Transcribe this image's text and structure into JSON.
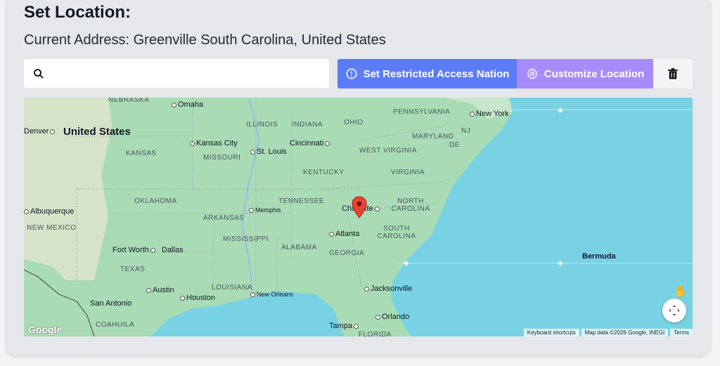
{
  "header": {
    "title": "Set Location:",
    "current_address": "Current Address: Greenville South Carolina, United States"
  },
  "search": {
    "placeholder": "",
    "value": "",
    "icon": "search-icon"
  },
  "buttons": {
    "restricted_label": "Set Restricted Access Nation",
    "restricted_icon": "alert-circle-icon",
    "restricted_color": "#5b7cf6",
    "customize_label": "Customize Location",
    "customize_icon": "gear-icon",
    "customize_color": "#a78bfa",
    "delete_icon": "trash-icon"
  },
  "map": {
    "country_label": "United States",
    "region_labels": [
      "NEBRASKA",
      "KANSAS",
      "MISSOURI",
      "ILLINOIS",
      "INDIANA",
      "OHIO",
      "PENNSYLVANIA",
      "MARYLAND",
      "WEST VIRGINIA",
      "VIRGINIA",
      "KENTUCKY",
      "TENNESSEE",
      "NORTH CAROLINA",
      "SOUTH CAROLINA",
      "GEORGIA",
      "ALABAMA",
      "MISSISSIPPI",
      "ARKANSAS",
      "OKLAHOMA",
      "TEXAS",
      "LOUISIANA",
      "NEW MEXICO",
      "COAHUILA",
      "FLORIDA",
      "NJ",
      "DE",
      "Bermuda"
    ],
    "cities": [
      "Omaha",
      "Denver",
      "Kansas City",
      "St. Louis",
      "Cincinnati",
      "New York",
      "Albuquerque",
      "Memphis",
      "Charlotte",
      "Atlanta",
      "Fort Worth",
      "Dallas",
      "Austin",
      "Houston",
      "New Orleans",
      "San Antonio",
      "Jacksonville",
      "Orlando",
      "Tampa"
    ],
    "marker_city": "Charlotte",
    "attribution": {
      "shortcuts": "Keyboard shortcuts",
      "data": "Map data ©2026 Google, INEGI",
      "terms": "Terms"
    },
    "logo": "Google"
  }
}
